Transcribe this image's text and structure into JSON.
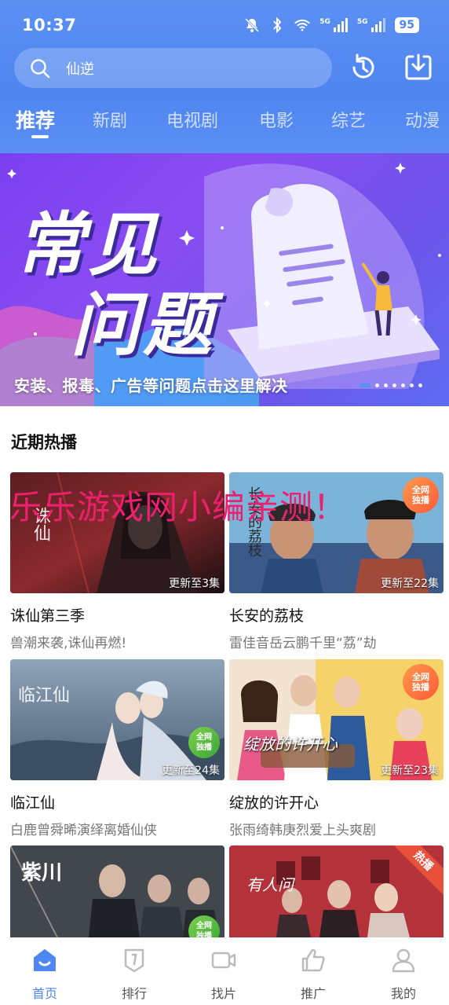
{
  "status_bar": {
    "time": "10:37",
    "signal_1": "5G",
    "signal_2": "5G",
    "battery": "95"
  },
  "search": {
    "placeholder": "仙逆"
  },
  "header": {
    "history_icon": "history-icon",
    "download_icon": "download-icon"
  },
  "categories": [
    "推荐",
    "新剧",
    "电视剧",
    "电影",
    "综艺",
    "动漫"
  ],
  "banner": {
    "title_line1": "常见",
    "title_line2": "问题",
    "caption": "安装、报毒、广告等问题点击这里解决"
  },
  "section_title": "近期热播",
  "watermark": "乐乐游戏网小编亲测！",
  "shows": [
    {
      "title": "诛仙第三季",
      "desc": "兽潮来袭,诛仙再燃!",
      "episode": "更新至3集",
      "logo_text": "诛仙"
    },
    {
      "title": "长安的荔枝",
      "desc": "雷佳音岳云鹏千里“荔”劫",
      "episode": "更新至22集",
      "badge": [
        "全网",
        "独播"
      ],
      "logo_text": "长安的荔枝"
    },
    {
      "title": "临江仙",
      "desc": "白鹿曾舜晞演绎离婚仙侠",
      "episode": "更新至24集",
      "badge": [
        "全网",
        "独播"
      ],
      "logo_text": "临江仙"
    },
    {
      "title": "绽放的许开心",
      "desc": "张雨绮韩庚烈爱上头爽剧",
      "episode": "更新至23集",
      "badge": [
        "全网",
        "独播"
      ],
      "logo_text": "绽放的许开心"
    },
    {
      "title": "",
      "desc": "",
      "episode": "",
      "badge": [
        "全网",
        "独播"
      ],
      "logo_text": "紫川"
    },
    {
      "title": "",
      "desc": "",
      "episode": "",
      "corner": "热播",
      "logo_text": "有人问"
    }
  ],
  "bottom_nav": [
    {
      "label": "首页",
      "icon": "home-icon",
      "active": true
    },
    {
      "label": "排行",
      "icon": "ranking-icon"
    },
    {
      "label": "找片",
      "icon": "video-camera-icon"
    },
    {
      "label": "推广",
      "icon": "thumbs-up-icon"
    },
    {
      "label": "我的",
      "icon": "profile-icon"
    }
  ],
  "colors": {
    "brand": "#4f86f0",
    "watermark": "#ee1f6e",
    "banner_purple": "#7a3ff0"
  }
}
